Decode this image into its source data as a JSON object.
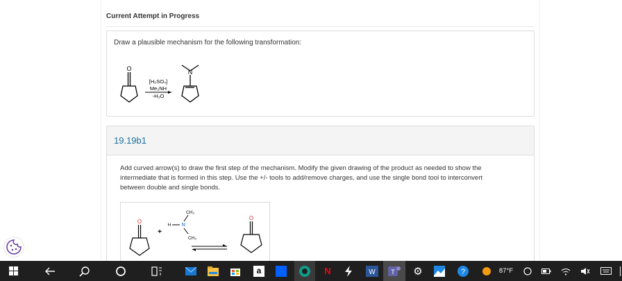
{
  "attempt": {
    "header": "Current Attempt in Progress"
  },
  "question": {
    "prompt": "Draw a plausible mechanism for the following transformation:",
    "scheme": {
      "reactant_atom": "O",
      "reagent_line1": "[H₂SO₄]",
      "reagent_line2": "Me₂NH",
      "reagent_line3": "-H₂O",
      "product_atom": "N"
    }
  },
  "part": {
    "title": "19.19b1",
    "instructions": "Add curved arrow(s) to draw the first step of the mechanism. Modify the given drawing of the product as needed to show the intermediate that is formed in this step. Use the +/- tools to add/remove charges, and use the single bond tool to interconvert between double and single bonds.",
    "drawing": {
      "plus": "+",
      "methyl_top": "CH₃",
      "methyl_bottom": "CH₃",
      "hydrogen": "H",
      "nitrogen": "N:",
      "oxygen_left": "O",
      "oxygen_right": "O"
    }
  },
  "taskbar": {
    "weather": "87°F",
    "icons": [
      "windows-start-icon",
      "back-arrow-icon",
      "search-icon",
      "cortana-icon",
      "task-view-icon",
      "mail-icon",
      "file-explorer-icon",
      "store-icon",
      "amazon-icon",
      "dropbox-icon",
      "edge-icon",
      "netflix-icon",
      "spark-icon",
      "word-icon",
      "teams-icon",
      "settings-icon",
      "photos-icon",
      "help-icon",
      "weather-icon"
    ]
  },
  "colors": {
    "link": "#1a6fa3",
    "taskbar": "#1f1f1f",
    "oxygen": "#d32f2f",
    "nitrogen": "#1565c0"
  }
}
